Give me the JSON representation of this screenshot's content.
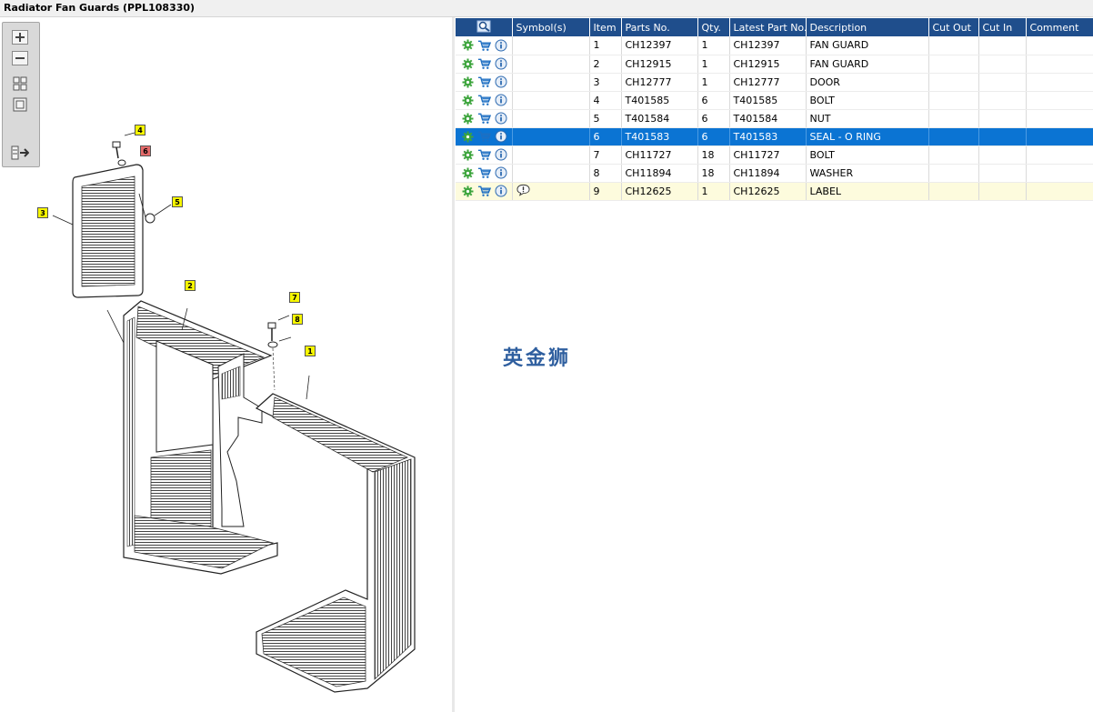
{
  "window": {
    "title": "Radiator Fan Guards (PPL108330)"
  },
  "toolbar": {
    "buttons": [
      {
        "name": "zoom-in",
        "icon": "plus-icon"
      },
      {
        "name": "zoom-out",
        "icon": "minus-icon"
      },
      {
        "name": "fit-all",
        "icon": "grid-icon"
      },
      {
        "name": "fit-window",
        "icon": "square-icon"
      },
      {
        "name": "pane-toggle",
        "icon": "split-arrow-icon"
      }
    ]
  },
  "callouts": [
    {
      "label": "1",
      "color": "yellow"
    },
    {
      "label": "2",
      "color": "yellow"
    },
    {
      "label": "3",
      "color": "yellow"
    },
    {
      "label": "4",
      "color": "yellow"
    },
    {
      "label": "5",
      "color": "yellow"
    },
    {
      "label": "6",
      "color": "red"
    },
    {
      "label": "7",
      "color": "yellow"
    },
    {
      "label": "8",
      "color": "yellow"
    }
  ],
  "table": {
    "columns": [
      "",
      "Symbol(s)",
      "Item",
      "Parts No.",
      "Qty.",
      "Latest Part No.",
      "Description",
      "Cut Out",
      "Cut In",
      "Comment"
    ],
    "rows": [
      {
        "item": "1",
        "parts_no": "CH12397",
        "qty": "1",
        "latest": "CH12397",
        "description": "FAN GUARD",
        "cut_out": "",
        "cut_in": "",
        "comment": ""
      },
      {
        "item": "2",
        "parts_no": "CH12915",
        "qty": "1",
        "latest": "CH12915",
        "description": "FAN GUARD",
        "cut_out": "",
        "cut_in": "",
        "comment": ""
      },
      {
        "item": "3",
        "parts_no": "CH12777",
        "qty": "1",
        "latest": "CH12777",
        "description": "DOOR",
        "cut_out": "",
        "cut_in": "",
        "comment": ""
      },
      {
        "item": "4",
        "parts_no": "T401585",
        "qty": "6",
        "latest": "T401585",
        "description": "BOLT",
        "cut_out": "",
        "cut_in": "",
        "comment": ""
      },
      {
        "item": "5",
        "parts_no": "T401584",
        "qty": "6",
        "latest": "T401584",
        "description": "NUT",
        "cut_out": "",
        "cut_in": "",
        "comment": ""
      },
      {
        "item": "6",
        "parts_no": "T401583",
        "qty": "6",
        "latest": "T401583",
        "description": "SEAL - O RING",
        "cut_out": "",
        "cut_in": "",
        "comment": ""
      },
      {
        "item": "7",
        "parts_no": "CH11727",
        "qty": "18",
        "latest": "CH11727",
        "description": "BOLT",
        "cut_out": "",
        "cut_in": "",
        "comment": ""
      },
      {
        "item": "8",
        "parts_no": "CH11894",
        "qty": "18",
        "latest": "CH11894",
        "description": "WASHER",
        "cut_out": "",
        "cut_in": "",
        "comment": ""
      },
      {
        "item": "9",
        "parts_no": "CH12625",
        "qty": "1",
        "latest": "CH12625",
        "description": "LABEL",
        "cut_out": "",
        "cut_in": "",
        "comment": ""
      }
    ],
    "selected_item": "6",
    "symbol_item": "9"
  },
  "watermark": {
    "text": "英金狮"
  },
  "colors": {
    "header": "#1f4e8c",
    "selected": "#0b74d3",
    "callout": "#f7f700",
    "callout_selected": "#e46a6a",
    "cart": "#1e6fc2",
    "gear": "#3da53d"
  }
}
